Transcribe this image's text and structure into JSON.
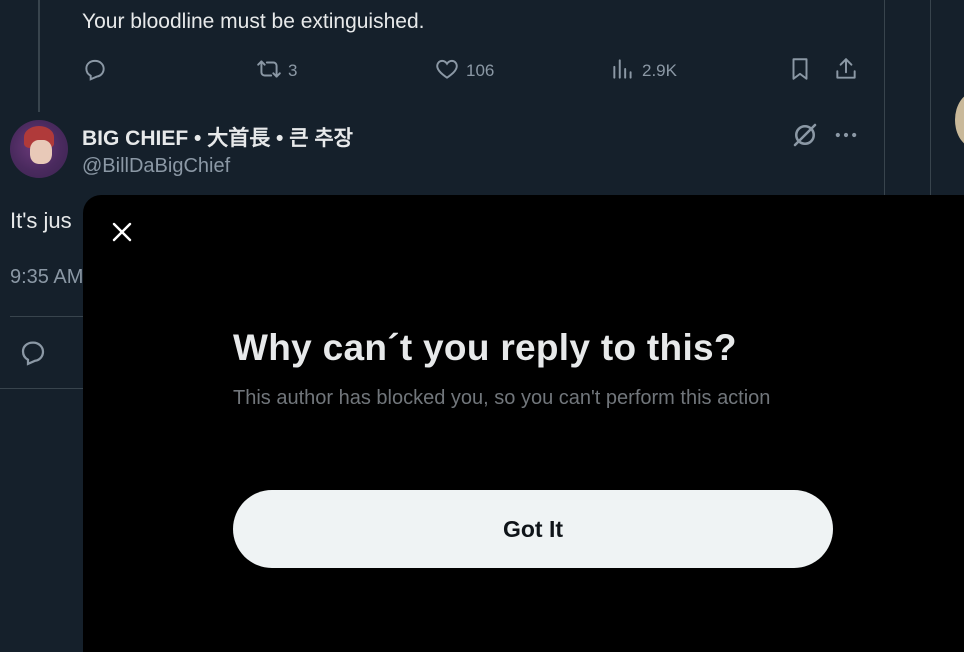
{
  "previous_tweet": {
    "text": "Your bloodline must be extinguished.",
    "actions": {
      "reply_icon": "reply-icon",
      "retweet_count": "3",
      "like_count": "106",
      "views_count": "2.9K"
    }
  },
  "tweet": {
    "author_name": "BIG CHIEF • 大首長 • 큰 추장",
    "author_handle": "@BillDaBigChief",
    "text_visible": "It's jus",
    "time_visible": "9:35 AM"
  },
  "modal": {
    "close_icon": "close-icon",
    "title": "Why can´t you reply to this?",
    "description": "This author has blocked you, so you can't perform this action",
    "button_label": "Got It"
  },
  "colors": {
    "background": "#15202b",
    "modal_bg": "#000000",
    "button_bg": "#eff3f4",
    "muted_text": "#8b98a5"
  }
}
